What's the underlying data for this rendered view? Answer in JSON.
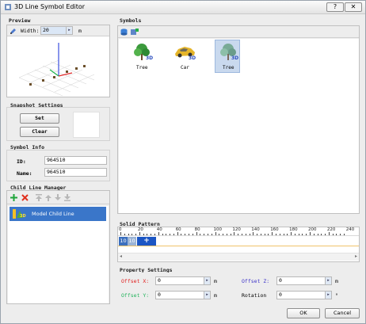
{
  "window": {
    "title": "3D Line Symbol Editor",
    "close": "✕",
    "help": "?"
  },
  "preview": {
    "label": "Preview",
    "width_label": "Width:",
    "width_value": "20",
    "unit": "m"
  },
  "snapshot": {
    "label": "Snapshot Settings",
    "set": "Set",
    "clear": "Clear"
  },
  "symbol_info": {
    "label": "Symbol Info",
    "id_label": "ID:",
    "id_value": "964510",
    "name_label": "Name:",
    "name_value": "964510"
  },
  "child_line": {
    "label": "Child Line Manager",
    "items": [
      {
        "label": "Model Child Line",
        "icon_badge": "3D"
      }
    ]
  },
  "symbols": {
    "label": "Symbols",
    "items": [
      {
        "label": "Tree",
        "badge": "3D"
      },
      {
        "label": "Car",
        "badge": "3D"
      },
      {
        "label": "Tree",
        "badge": "3D"
      }
    ]
  },
  "solid_pattern": {
    "label": "Solid Pattern",
    "ticks": [
      "0",
      "20",
      "40",
      "60",
      "80",
      "100",
      "120",
      "140",
      "160",
      "180",
      "200",
      "220",
      "240"
    ],
    "cells": [
      "10",
      "10"
    ],
    "add": "+"
  },
  "property": {
    "label": "Property Settings",
    "offset_x_label": "Offset X:",
    "offset_x": "0",
    "offset_y_label": "Offset Y:",
    "offset_y": "0",
    "offset_z_label": "Offset Z:",
    "offset_z": "0",
    "rotation_label": "Rotation",
    "rotation": "0",
    "unit_m": "m",
    "unit_deg": "°"
  },
  "footer": {
    "ok": "OK",
    "cancel": "Cancel"
  },
  "colors": {
    "selection": "#3a76c9",
    "offset_x": "#e0201f",
    "offset_y": "#22b35c",
    "offset_z": "#3f35c9"
  }
}
